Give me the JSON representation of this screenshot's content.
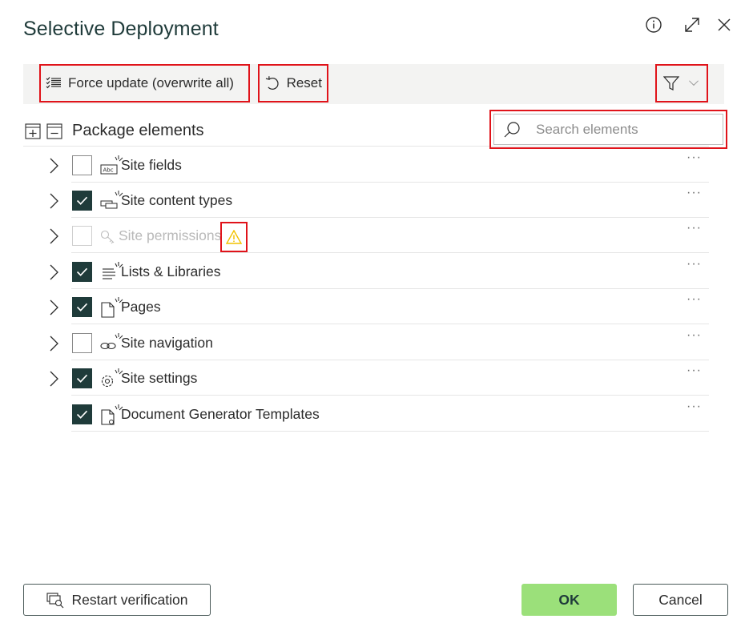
{
  "dialog": {
    "title": "Selective Deployment",
    "header_icons": [
      "info-icon",
      "expand-icon",
      "close-icon"
    ]
  },
  "toolbar": {
    "force_update_label": "Force update (overwrite all)",
    "reset_label": "Reset"
  },
  "tree": {
    "header_label": "Package elements",
    "search_placeholder": "Search elements",
    "items": [
      {
        "label": "Site fields",
        "checked": false,
        "expandable": true,
        "disabled": false,
        "icon": "site-fields-icon"
      },
      {
        "label": "Site content types",
        "checked": true,
        "expandable": true,
        "disabled": false,
        "icon": "content-types-icon"
      },
      {
        "label": "Site permissions",
        "checked": false,
        "expandable": true,
        "disabled": true,
        "icon": "key-icon",
        "warning": true
      },
      {
        "label": "Lists & Libraries",
        "checked": true,
        "expandable": true,
        "disabled": false,
        "icon": "list-icon"
      },
      {
        "label": "Pages",
        "checked": true,
        "expandable": true,
        "disabled": false,
        "icon": "page-icon"
      },
      {
        "label": "Site navigation",
        "checked": false,
        "expandable": true,
        "disabled": false,
        "icon": "link-icon"
      },
      {
        "label": "Site settings",
        "checked": true,
        "expandable": true,
        "disabled": false,
        "icon": "settings-gear-icon"
      },
      {
        "label": "Document Generator Templates",
        "checked": true,
        "expandable": false,
        "disabled": false,
        "icon": "document-template-icon"
      }
    ],
    "more_label": "···"
  },
  "footer": {
    "restart_label": "Restart verification",
    "ok_label": "OK",
    "cancel_label": "Cancel"
  },
  "colors": {
    "accent_dark": "#1f3b3a",
    "ok_green": "#9be07a",
    "highlight_red": "#e0131a",
    "warning_yellow": "#f2c200"
  }
}
